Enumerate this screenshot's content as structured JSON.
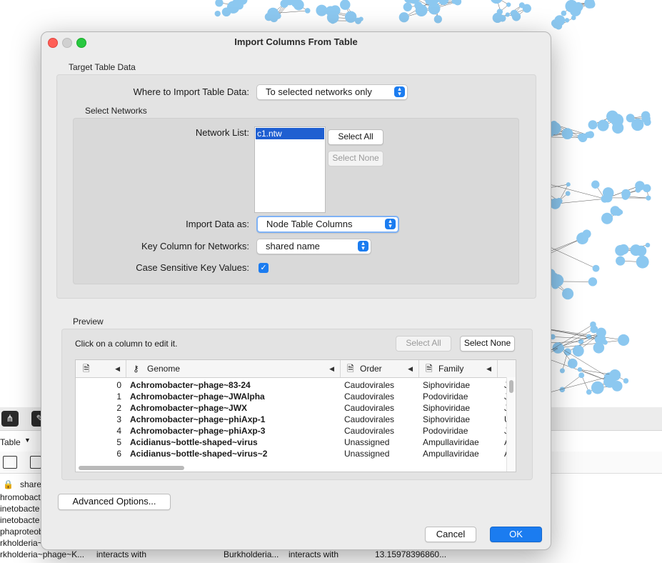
{
  "dialog": {
    "title": "Import Columns From Table",
    "target_section": "Target Table Data",
    "where_label": "Where to Import Table Data:",
    "where_value": "To selected networks only",
    "select_networks_section": "Select Networks",
    "network_list_label": "Network List:",
    "network_list_items": [
      "c1.ntw"
    ],
    "select_all_label": "Select All",
    "select_none_label": "Select None",
    "import_as_label": "Import Data as:",
    "import_as_value": "Node Table Columns",
    "key_column_label": "Key Column for Networks:",
    "key_column_value": "shared name",
    "case_sensitive_label": "Case Sensitive Key Values:",
    "case_sensitive_checked": true,
    "preview_section": "Preview",
    "preview_hint": "Click on a column to edit it.",
    "preview_select_all": "Select All",
    "preview_select_none": "Select None",
    "advanced_label": "Advanced Options...",
    "cancel_label": "Cancel",
    "ok_label": "OK"
  },
  "preview_table": {
    "columns": [
      "",
      "Genome",
      "Order",
      "Family"
    ],
    "rows": [
      {
        "idx": "0",
        "genome": "Achromobacter~phage~83-24",
        "order": "Caudovirales",
        "family": "Siphoviridae",
        "extra": "J"
      },
      {
        "idx": "1",
        "genome": "Achromobacter~phage~JWAlpha",
        "order": "Caudovirales",
        "family": "Podoviridae",
        "extra": "J"
      },
      {
        "idx": "2",
        "genome": "Achromobacter~phage~JWX",
        "order": "Caudovirales",
        "family": "Siphoviridae",
        "extra": "J"
      },
      {
        "idx": "3",
        "genome": "Achromobacter~phage~phiAxp-1",
        "order": "Caudovirales",
        "family": "Siphoviridae",
        "extra": "U"
      },
      {
        "idx": "4",
        "genome": "Achromobacter~phage~phiAxp-3",
        "order": "Caudovirales",
        "family": "Podoviridae",
        "extra": "J"
      },
      {
        "idx": "5",
        "genome": "Acidianus~bottle-shaped~virus",
        "order": "Unassigned",
        "family": "Ampullaviridae",
        "extra": "A"
      },
      {
        "idx": "6",
        "genome": "Acidianus~bottle-shaped~virus~2",
        "order": "Unassigned",
        "family": "Ampullaviridae",
        "extra": "A"
      }
    ]
  },
  "background": {
    "table_tab": "Table",
    "share_label": "share",
    "rows": [
      {
        "name": "hromobact"
      },
      {
        "name": "inetobacte"
      },
      {
        "name": "inetobacte"
      },
      {
        "name": "phaproteob"
      },
      {
        "name": "rkholderia~"
      },
      {
        "name": "rkholderia~phage~K...",
        "interaction": "interacts with",
        "target": "Burkholderia...",
        "interaction2": "interacts with",
        "value": "13.15978396860..."
      }
    ]
  },
  "colors": {
    "accent": "#1b7cf0",
    "node": "#8cc8f0",
    "selection": "#1f5fd1"
  }
}
